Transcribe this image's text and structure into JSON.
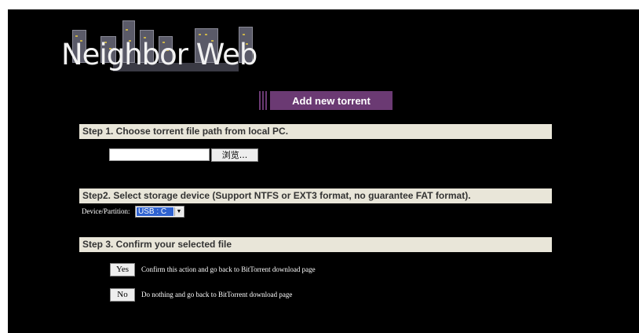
{
  "logo": {
    "text": "Neighbor Web"
  },
  "header": {
    "title": "Add new torrent"
  },
  "step1": {
    "heading": "Step 1. Choose torrent file path from local PC.",
    "file_value": "",
    "browse_label": "浏览..."
  },
  "step2": {
    "heading": "Step2. Select storage device (Support NTFS or EXT3 format, no guarantee FAT format).",
    "device_label": "Device/Partition:",
    "device_value": "USB : C"
  },
  "step3": {
    "heading": "Step 3. Confirm your selected file",
    "yes_label": "Yes",
    "yes_desc": "Confirm this action and go back to BitTorrent download page",
    "no_label": "No",
    "no_desc": "Do nothing and go back to BitTorrent download page"
  },
  "colors": {
    "accent": "#6b3a73",
    "step_bg": "#e9e6d9",
    "background": "#000000"
  }
}
